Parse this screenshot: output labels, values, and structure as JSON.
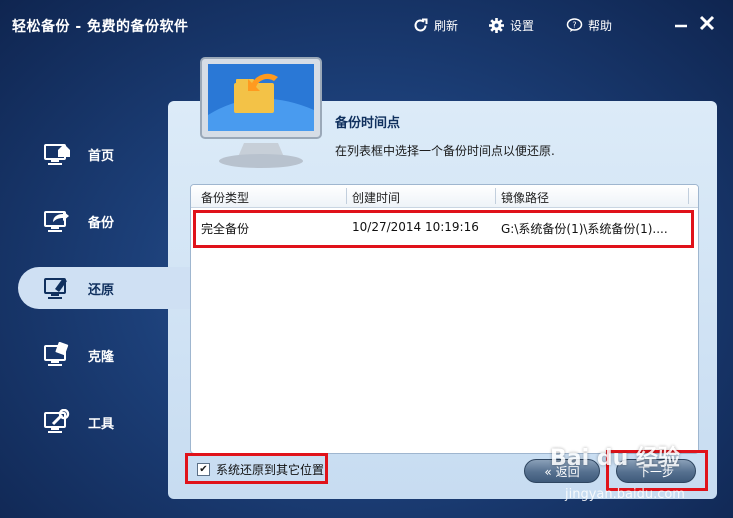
{
  "app": {
    "title": "轻松备份 - 免费的备份软件"
  },
  "toolbar": {
    "refresh_label": "刷新",
    "settings_label": "设置",
    "help_label": "帮助"
  },
  "sidebar": {
    "items": [
      {
        "label": "首页",
        "icon": "home-monitor-icon"
      },
      {
        "label": "备份",
        "icon": "backup-monitor-icon"
      },
      {
        "label": "还原",
        "icon": "restore-monitor-icon",
        "active": true
      },
      {
        "label": "克隆",
        "icon": "clone-monitor-icon"
      },
      {
        "label": "工具",
        "icon": "tools-monitor-icon"
      }
    ]
  },
  "main": {
    "section_title": "备份时间点",
    "section_desc": "在列表框中选择一个备份时间点以便还原.",
    "table": {
      "columns": [
        "备份类型",
        "创建时间",
        "镜像路径"
      ],
      "rows": [
        {
          "type": "完全备份",
          "created": "10/27/2014 10:19:16",
          "path": "G:\\系统备份(1)\\系统备份(1)...."
        }
      ]
    },
    "checkbox_label": "系统还原到其它位置",
    "checkbox_checked": true,
    "back_label": "« 返回",
    "next_label": "下一步"
  },
  "watermark": {
    "brand": "Bai du 经验",
    "url": "jingyan.baidu.com"
  },
  "colors": {
    "accent_red": "#e0121a",
    "panel_bg": "#cfe0f3",
    "window_bg": "#1c3f78"
  }
}
